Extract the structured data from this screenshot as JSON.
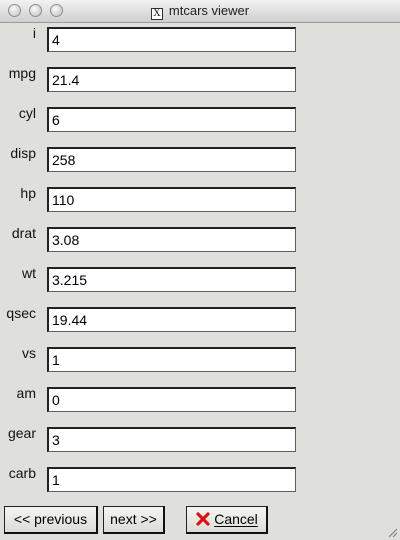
{
  "window": {
    "title": "mtcars viewer"
  },
  "fields": [
    {
      "label": "i",
      "value": "4"
    },
    {
      "label": "mpg",
      "value": "21.4"
    },
    {
      "label": "cyl",
      "value": "6"
    },
    {
      "label": "disp",
      "value": "258"
    },
    {
      "label": "hp",
      "value": "110"
    },
    {
      "label": "drat",
      "value": "3.08"
    },
    {
      "label": "wt",
      "value": "3.215"
    },
    {
      "label": "qsec",
      "value": "19.44"
    },
    {
      "label": "vs",
      "value": "1"
    },
    {
      "label": "am",
      "value": "0"
    },
    {
      "label": "gear",
      "value": "3"
    },
    {
      "label": "carb",
      "value": "1"
    }
  ],
  "buttons": {
    "previous": "<< previous",
    "next": "next >>",
    "cancel": "Cancel"
  },
  "icons": {
    "title_icon": "x11-icon",
    "cancel_icon": "red-x-icon"
  }
}
